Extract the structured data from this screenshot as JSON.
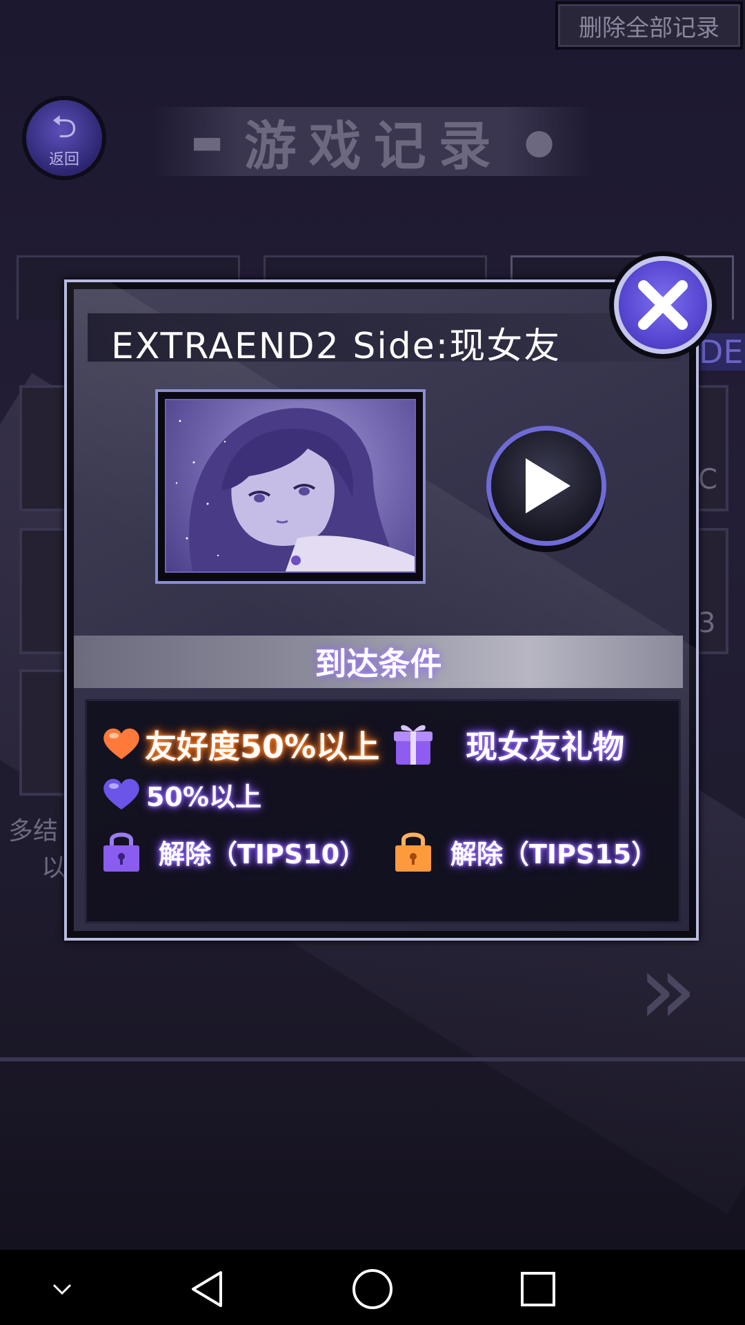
{
  "background": {
    "delete_all_label": "删除全部记录",
    "back_label": "返回",
    "page_title": "游戏记录",
    "side_text_left_1": "多结",
    "side_text_left_2": "以",
    "side_text_right_tab": "DE",
    "side_text_right_1": "C",
    "side_text_right_2": "3"
  },
  "modal": {
    "title": "EXTRAEND2 Side:现女友",
    "conditions_header": "到达条件",
    "conditions": [
      {
        "icon": "heart-orange-icon",
        "text": "友好度50%以上",
        "color": "orange"
      },
      {
        "icon": "gift-icon",
        "text": "现女友礼物",
        "color": "purple"
      },
      {
        "icon": "heart-purple-icon",
        "text": "50%以上",
        "color": "purple"
      },
      {
        "icon": "lock-purple-icon",
        "text": "解除（TIPS10）",
        "color": "purple"
      },
      {
        "icon": "lock-orange-icon",
        "text": "解除（TIPS15）",
        "color": "orange"
      }
    ]
  },
  "colors": {
    "accent_purple": "#5747d2",
    "glow_orange": "#ff7a20",
    "glow_purple": "#8a5cff",
    "frame_border": "#b9bbe0"
  },
  "navbar": {
    "buttons": [
      "chevron-down-icon",
      "back-triangle-icon",
      "home-circle-icon",
      "recents-square-icon"
    ]
  }
}
